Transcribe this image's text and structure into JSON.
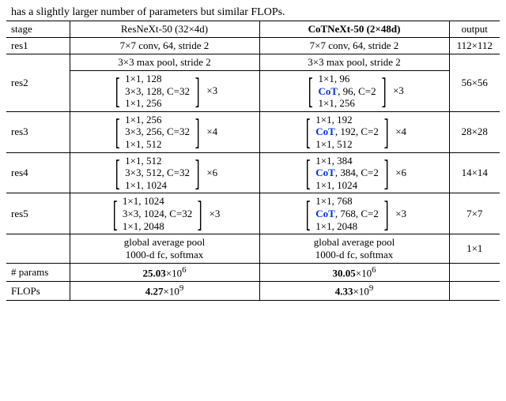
{
  "caption": "has a slightly larger number of parameters but similar FLOPs.",
  "header": {
    "c0": "stage",
    "c1": "ResNeXt-50 (32×4d)",
    "c2": "CoTNeXt-50 (2×48d)",
    "c3": "output"
  },
  "res1": {
    "label": "res1",
    "a": "7×7 conv, 64, stride 2",
    "b": "7×7 conv, 64, stride 2",
    "out": "112×112"
  },
  "res2": {
    "label": "res2",
    "pool_a": "3×3 max pool, stride 2",
    "pool_b": "3×3 max pool, stride 2",
    "a0": "1×1, 128",
    "a1": "3×3, 128, C=32",
    "a2": "1×1, 256",
    "am": "×3",
    "b0": "1×1, 96",
    "b1_pre": "CoT",
    "b1_post": ", 96, C=2",
    "b2": "1×1, 256",
    "bm": "×3",
    "out": "56×56"
  },
  "res3": {
    "label": "res3",
    "a0": "1×1, 256",
    "a1": "3×3, 256, C=32",
    "a2": "1×1, 512",
    "am": "×4",
    "b0": "1×1, 192",
    "b1_pre": "CoT",
    "b1_post": ", 192, C=2",
    "b2": "1×1, 512",
    "bm": "×4",
    "out": "28×28"
  },
  "res4": {
    "label": "res4",
    "a0": "1×1, 512",
    "a1": "3×3, 512, C=32",
    "a2": "1×1, 1024",
    "am": "×6",
    "b0": "1×1, 384",
    "b1_pre": "CoT",
    "b1_post": ", 384, C=2",
    "b2": "1×1, 1024",
    "bm": "×6",
    "out": "14×14"
  },
  "res5": {
    "label": "res5",
    "a0": "1×1, 1024",
    "a1": "3×3, 1024, C=32",
    "a2": "1×1, 2048",
    "am": "×3",
    "b0": "1×1, 768",
    "b1_pre": "CoT",
    "b1_post": ", 768, C=2",
    "b2": "1×1, 2048",
    "bm": "×3",
    "out": "7×7"
  },
  "footer": {
    "gap_a": "global average pool",
    "fc_a": "1000-d fc, softmax",
    "gap_b": "global average pool",
    "fc_b": "1000-d fc, softmax",
    "out": "1×1",
    "params_label": "# params",
    "params_a_val": "25.03",
    "params_a_exp": "×10",
    "params_a_sup": "6",
    "params_b_val": "30.05",
    "params_b_exp": "×10",
    "params_b_sup": "6",
    "flops_label": "FLOPs",
    "flops_a_val": "4.27",
    "flops_a_exp": "×10",
    "flops_a_sup": "9",
    "flops_b_val": "4.33",
    "flops_b_exp": "×10",
    "flops_b_sup": "9"
  }
}
